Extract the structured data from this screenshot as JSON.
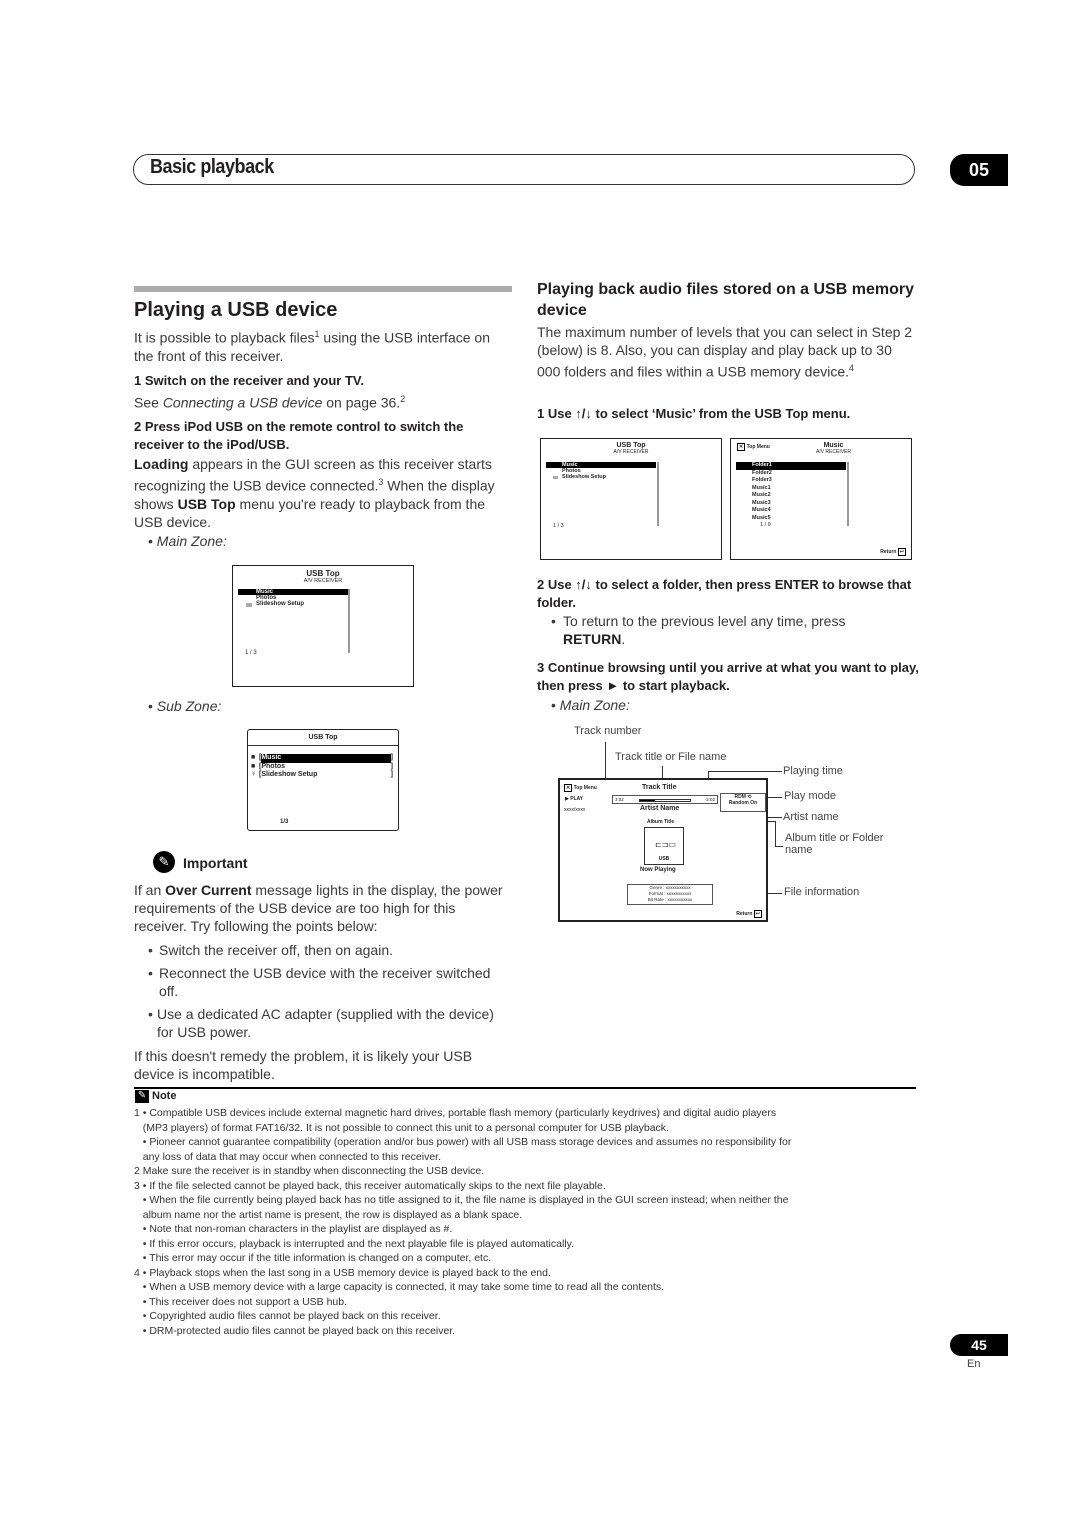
{
  "header": {
    "title": "Basic playback",
    "chapter": "05"
  },
  "left": {
    "heading": "Playing a USB device",
    "intro_a": "It is possible to playback files",
    "intro_sup": "1",
    "intro_b": " using the USB interface on the front of this receiver.",
    "step1_title": "1   Switch on the receiver and your TV.",
    "step1_see": "See ",
    "step1_link": "Connecting a USB device",
    "step1_page": " on page 36.",
    "step1_sup": "2",
    "step2_title": "2   Press iPod USB on the remote control to switch the receiver to the iPod/USB.",
    "step2_bold1": "Loading",
    "step2_t1": " appears in the GUI screen as this receiver starts recognizing the USB device connected.",
    "step2_sup": "3",
    "step2_t2": " When the display shows ",
    "step2_bold2": "USB Top",
    "step2_t3": " menu you're ready to playback from the USB device.",
    "main_zone": "Main Zone:",
    "sub_zone": "Sub Zone:",
    "important_title": "Important",
    "imp_a": "If an ",
    "imp_bold": "Over Current",
    "imp_b": " message lights in the display, the power requirements of the USB device are too high for this receiver. Try following the points below:",
    "imp_bullets": [
      "Switch the receiver off, then on again.",
      "Reconnect the USB device with the receiver switched off.",
      "Use a dedicated AC adapter (supplied with the device) for USB power."
    ],
    "imp_end": "If this doesn't remedy the problem, it is likely your USB device is incompatible."
  },
  "screen_usbtop": {
    "title": "USB Top",
    "subtitle": "A/V RECEIVER",
    "items": [
      "Music",
      "Photos",
      "Slideshow Setup"
    ],
    "page": "1 / 3"
  },
  "screen_sub": {
    "title": "USB Top",
    "items": [
      "Music",
      "Photos",
      "Slideshow Setup"
    ],
    "page": "1/3"
  },
  "screen_music": {
    "top_menu": "Top Menu",
    "title": "Music",
    "subtitle": "A/V RECEIVER",
    "items": [
      "Folder1",
      "Folder2",
      "Folder3",
      "Music1",
      "Music2",
      "Music3",
      "Music4",
      "Music5"
    ],
    "page": "1 / 9",
    "return": "Return"
  },
  "right": {
    "heading": "Playing back audio files stored on a USB memory device",
    "intro": "The maximum number of levels that you can select in Step 2 (below) is 8. Also, you can display and play back up to 30 000 folders and files within a USB memory device.",
    "intro_sup": "4",
    "step1": "1   Use ↑/↓ to select ‘Music’ from the USB Top menu.",
    "step2": "2   Use ↑/↓ to select a folder, then press ENTER to browse that folder.",
    "step2_bullet_a": "To return to the previous level any time, press ",
    "step2_bullet_bold": "RETURN",
    "step3": "3   Continue browsing until you arrive at what you want to play, then press ► to start playback.",
    "main_zone": "Main Zone:"
  },
  "now_playing": {
    "top_menu": "Top Menu",
    "play": "PLAY",
    "track_no": "xxxx/xxxx",
    "track_title": "Track Title",
    "elapsed": "3:02",
    "remaining": "-2:02",
    "progress_fraction": 0.3,
    "mode_icon": "RDM",
    "mode": "Random On",
    "artist": "Artist Name",
    "album": "Album Title",
    "usb": "USB",
    "now_playing": "Now Playing",
    "genre": "Genre : xxxxxxxxxxx",
    "format": "Format : xxxxxxxxxxx",
    "bitrate": "Bit Rate : xxxxxxxxxxx",
    "return": "Return",
    "callouts": {
      "track_number": "Track number",
      "track_title": "Track title or File name",
      "playing_time": "Playing time",
      "play_mode": "Play mode",
      "artist_name": "Artist name",
      "album_title": "Album title or Folder name",
      "file_info": "File information"
    }
  },
  "notes": {
    "title": "Note",
    "lines": [
      "1 • Compatible USB devices include external magnetic hard drives, portable flash memory (particularly keydrives) and digital audio players",
      "   (MP3 players) of format FAT16/32. It is not possible to connect this unit to a personal computer for USB playback.",
      "   • Pioneer cannot guarantee compatibility (operation and/or bus power) with all USB mass storage devices and assumes no responsibility for",
      "   any loss of data that may occur when connected to this receiver.",
      "2 Make sure the receiver is in standby when disconnecting the USB device.",
      "3 • If the file selected cannot be played back, this receiver automatically skips to the next file playable.",
      "   • When the file currently being played back has no title assigned to it, the file name is displayed in the GUI screen instead; when neither the",
      "   album name nor the artist name is present, the row is displayed as a blank space.",
      "   • Note that non-roman characters in the playlist are displayed as #.",
      "   • If this error occurs, playback is interrupted and the next playable file is played automatically.",
      "   • This error may occur if the title information is changed on a computer, etc.",
      "4 • Playback stops when the last song in a USB memory device is played back to the end.",
      "   • When a USB memory device with a large capacity is connected, it may take some time to read all the contents.",
      "   • This receiver does not support a USB hub.",
      "   • Copyrighted audio files cannot be played back on this receiver.",
      "   • DRM-protected audio files cannot be played back on this receiver."
    ]
  },
  "footer": {
    "page": "45",
    "lang": "En"
  }
}
